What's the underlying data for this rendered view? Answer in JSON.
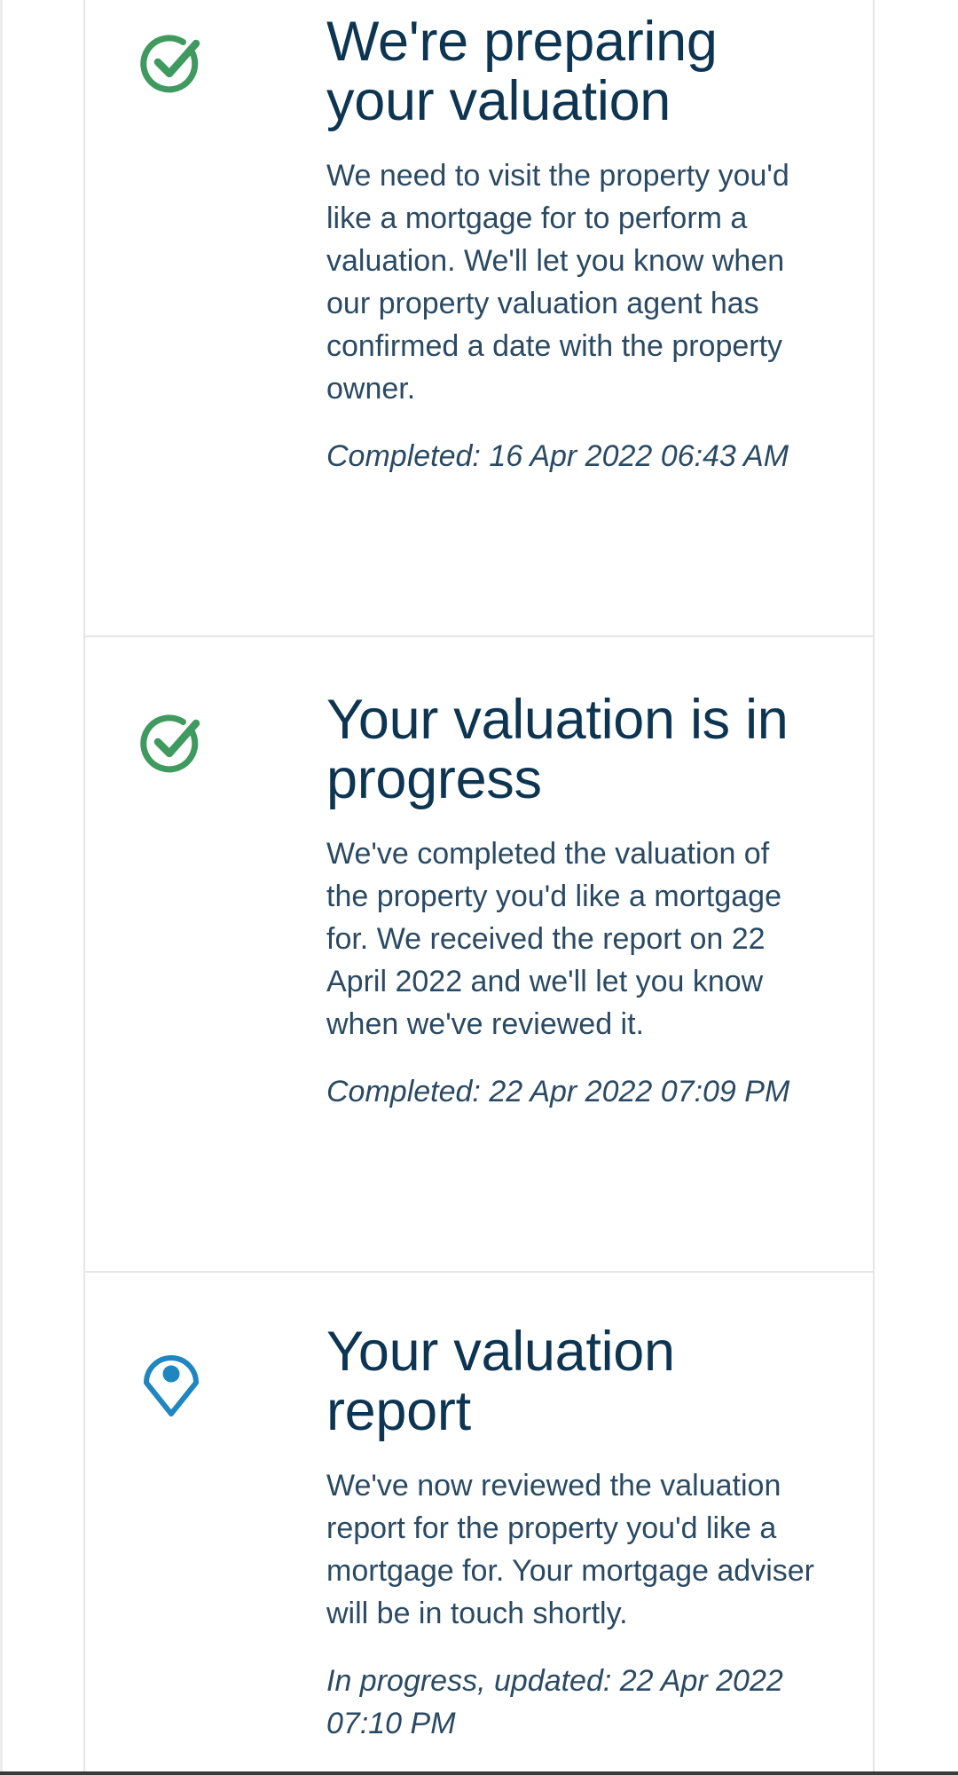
{
  "steps": [
    {
      "icon": "check-circle-icon",
      "icon_color": "#3f9a5f",
      "title": "We're preparing your valuation",
      "description": "We need to visit the property you'd like a mortgage for to perform a valuation. We'll let you know when our property valuation agent has confirmed a date with the property owner.",
      "status": "Completed: 16 Apr 2022 06:43 AM"
    },
    {
      "icon": "check-circle-icon",
      "icon_color": "#3f9a5f",
      "title": "Your valuation is in progress",
      "description": "We've completed the valuation of the property you'd like a mortgage for. We received the report on 22 April 2022 and we'll let you know when we've reviewed it.",
      "status": "Completed: 22 Apr 2022 07:09 PM"
    },
    {
      "icon": "location-pin-icon",
      "icon_color": "#1f86c0",
      "title": "Your valuation report",
      "description": "We've now reviewed the valuation report for the property you'd like a mortgage for. Your mortgage adviser will be in touch shortly.",
      "status": "In progress, updated: 22 Apr 2022 07:10 PM"
    }
  ]
}
